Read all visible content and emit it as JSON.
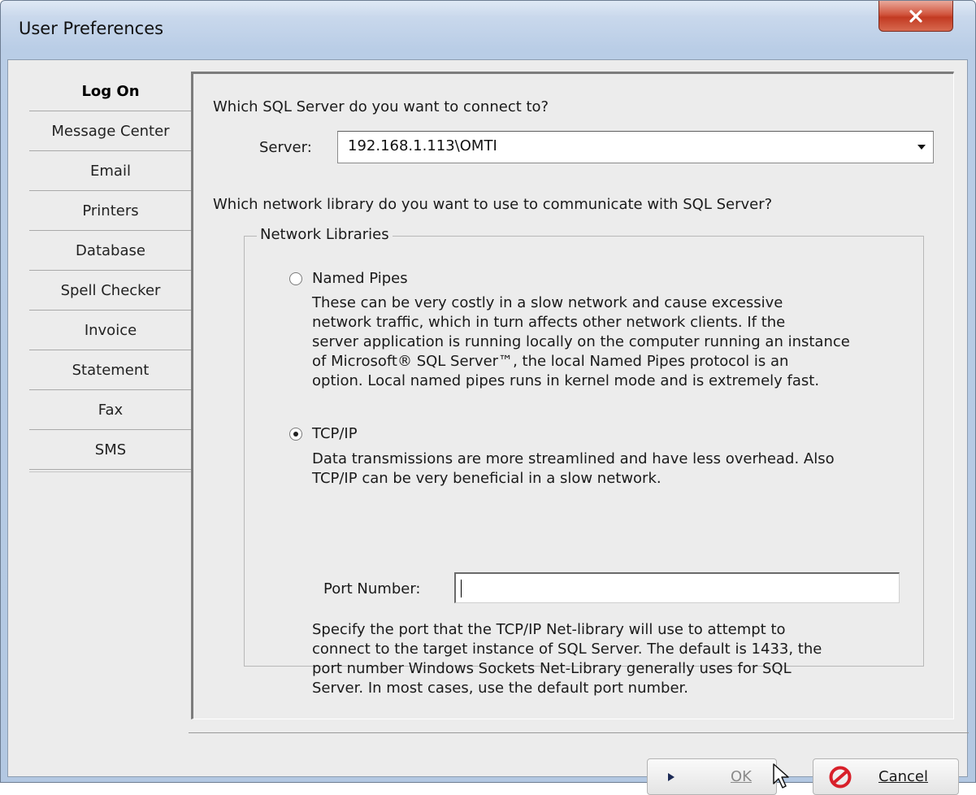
{
  "window": {
    "title": "User Preferences"
  },
  "sidebar": {
    "items": [
      {
        "label": "Log On",
        "active": true
      },
      {
        "label": "Message Center"
      },
      {
        "label": "Email"
      },
      {
        "label": "Printers"
      },
      {
        "label": "Database"
      },
      {
        "label": "Spell Checker"
      },
      {
        "label": "Invoice"
      },
      {
        "label": "Statement"
      },
      {
        "label": "Fax"
      },
      {
        "label": "SMS"
      }
    ]
  },
  "logon": {
    "server_question": "Which SQL Server do you want to connect to?",
    "server_label": "Server:",
    "server_value": "192.168.1.113\\OMTI",
    "library_question": "Which network library do you want to use to communicate with SQL Server?",
    "group_label": "Network Libraries",
    "named_pipes": {
      "label": "Named Pipes",
      "selected": false,
      "desc": [
        "These can be very costly in a slow network and cause excessive",
        "network traffic, which in turn affects other network clients. If the",
        "server application is running locally on the computer running an instance",
        "of Microsoft® SQL Server™, the local Named Pipes protocol is an",
        "option. Local named pipes runs in kernel mode and is extremely fast."
      ]
    },
    "tcpip": {
      "label": "TCP/IP",
      "selected": true,
      "desc": [
        "Data transmissions are more streamlined and have less overhead. Also",
        "TCP/IP can be very beneficial in a slow network."
      ],
      "port_label": "Port Number:",
      "port_value": "",
      "port_desc": [
        "Specify the port that the TCP/IP Net-library will use to attempt to",
        "connect to the target instance of SQL Server. The default is 1433, the",
        "port number Windows Sockets Net-Library generally uses for SQL",
        "Server. In most cases, use the default port number."
      ]
    }
  },
  "buttons": {
    "ok_label": "OK",
    "cancel_label": "Cancel"
  },
  "icons": {
    "close": "close-icon",
    "ok": "play-arrow-icon",
    "cancel": "no-entry-icon",
    "dropdown": "chevron-down-icon",
    "cursor": "mouse-pointer-icon"
  },
  "colors": {
    "close_button": "#c8442c",
    "cancel_icon": "#d8202a",
    "title_bar": "#c9d8ec"
  }
}
